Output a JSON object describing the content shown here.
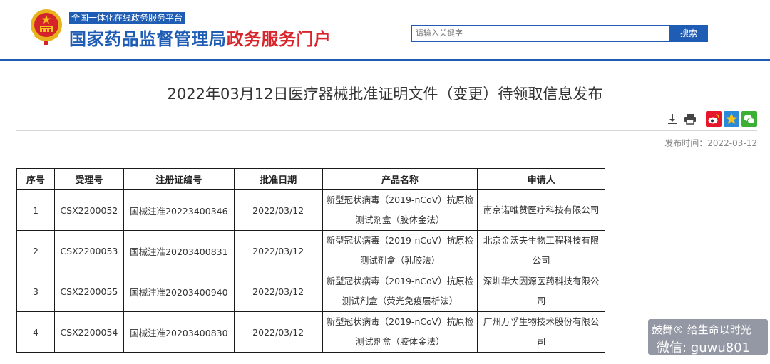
{
  "header": {
    "tagline": "全国一体化在线政务服务平台",
    "brand_blue": "国家药品监督管理局",
    "brand_red": "政务服务门户",
    "search_placeholder": "请输入关键字",
    "search_button": "搜索"
  },
  "article": {
    "title": "2022年03月12日医疗器械批准证明文件（变更）待领取信息发布",
    "pubdate": "发布时间：2022-03-12",
    "tools": [
      "download-icon",
      "print-icon",
      "weibo-icon",
      "qzone-icon",
      "wechat-icon"
    ]
  },
  "table": {
    "headers": [
      "序号",
      "受理号",
      "注册证编号",
      "批准日期",
      "产品名称",
      "申请人"
    ],
    "rows": [
      {
        "no": "1",
        "accept": "CSX2200052",
        "reg": "国械注准20223400346",
        "date": "2022/03/12",
        "product": "新型冠状病毒（2019-nCoV）抗原检测试剂盒（胶体金法）",
        "applicant": "南京诺唯赞医疗科技有限公司"
      },
      {
        "no": "2",
        "accept": "CSX2200053",
        "reg": "国械注准20203400831",
        "date": "2022/03/12",
        "product": "新型冠状病毒（2019-nCoV）抗原检测试剂盒（乳胶法）",
        "applicant": "北京金沃夫生物工程科技有限公司"
      },
      {
        "no": "3",
        "accept": "CSX2200055",
        "reg": "国械注准20203400940",
        "date": "2022/03/12",
        "product": "新型冠状病毒（2019-nCoV）抗原检测试剂盒（荧光免疫层析法）",
        "applicant": "深圳华大因源医药科技有限公司"
      },
      {
        "no": "4",
        "accept": "CSX2200054",
        "reg": "国械注准20203400830",
        "date": "2022/03/12",
        "product": "新型冠状病毒（2019-nCoV）抗原检测试剂盒（胶体金法）",
        "applicant": "广州万孚生物技术股份有限公司"
      }
    ]
  },
  "watermark": {
    "line1": "鼓舞® 给生命以时光",
    "line2": "微信: guwu801"
  },
  "colors": {
    "brand_blue": "#1f5db4",
    "brand_red": "#d8262c"
  }
}
